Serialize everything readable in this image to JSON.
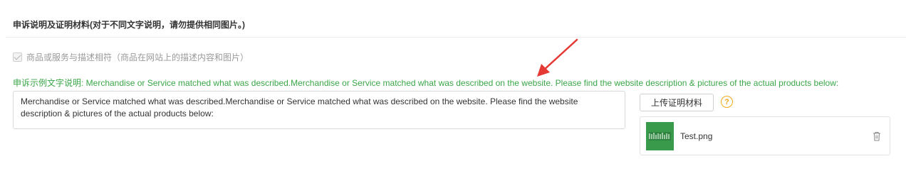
{
  "section": {
    "title": "申诉说明及证明材料(对于不同文字说明，请勿提供相同图片。)"
  },
  "checkbox": {
    "label": "商品或服务与描述相符（商品在网站上的描述内容和图片）",
    "checked": true
  },
  "example": {
    "text": "申诉示例文字说明: Merchandise or Service matched what was described.Merchandise or Service matched what was described on the website. Please find the website description & pictures of the actual products below:"
  },
  "statement": {
    "value": "Merchandise or Service matched what was described.Merchandise or Service matched what was described on the website. Please find the website description & pictures of the actual products below:"
  },
  "upload": {
    "button_label": "上传证明材料",
    "help_glyph": "?"
  },
  "file": {
    "name": "Test.png",
    "thumb_icon": "image-thumbnail",
    "delete_icon": "trash-icon"
  },
  "colors": {
    "example_green": "#3aa648",
    "help_orange": "#f2a91c",
    "annotation_red": "#e53935",
    "thumb_green": "#3a9a4c"
  }
}
